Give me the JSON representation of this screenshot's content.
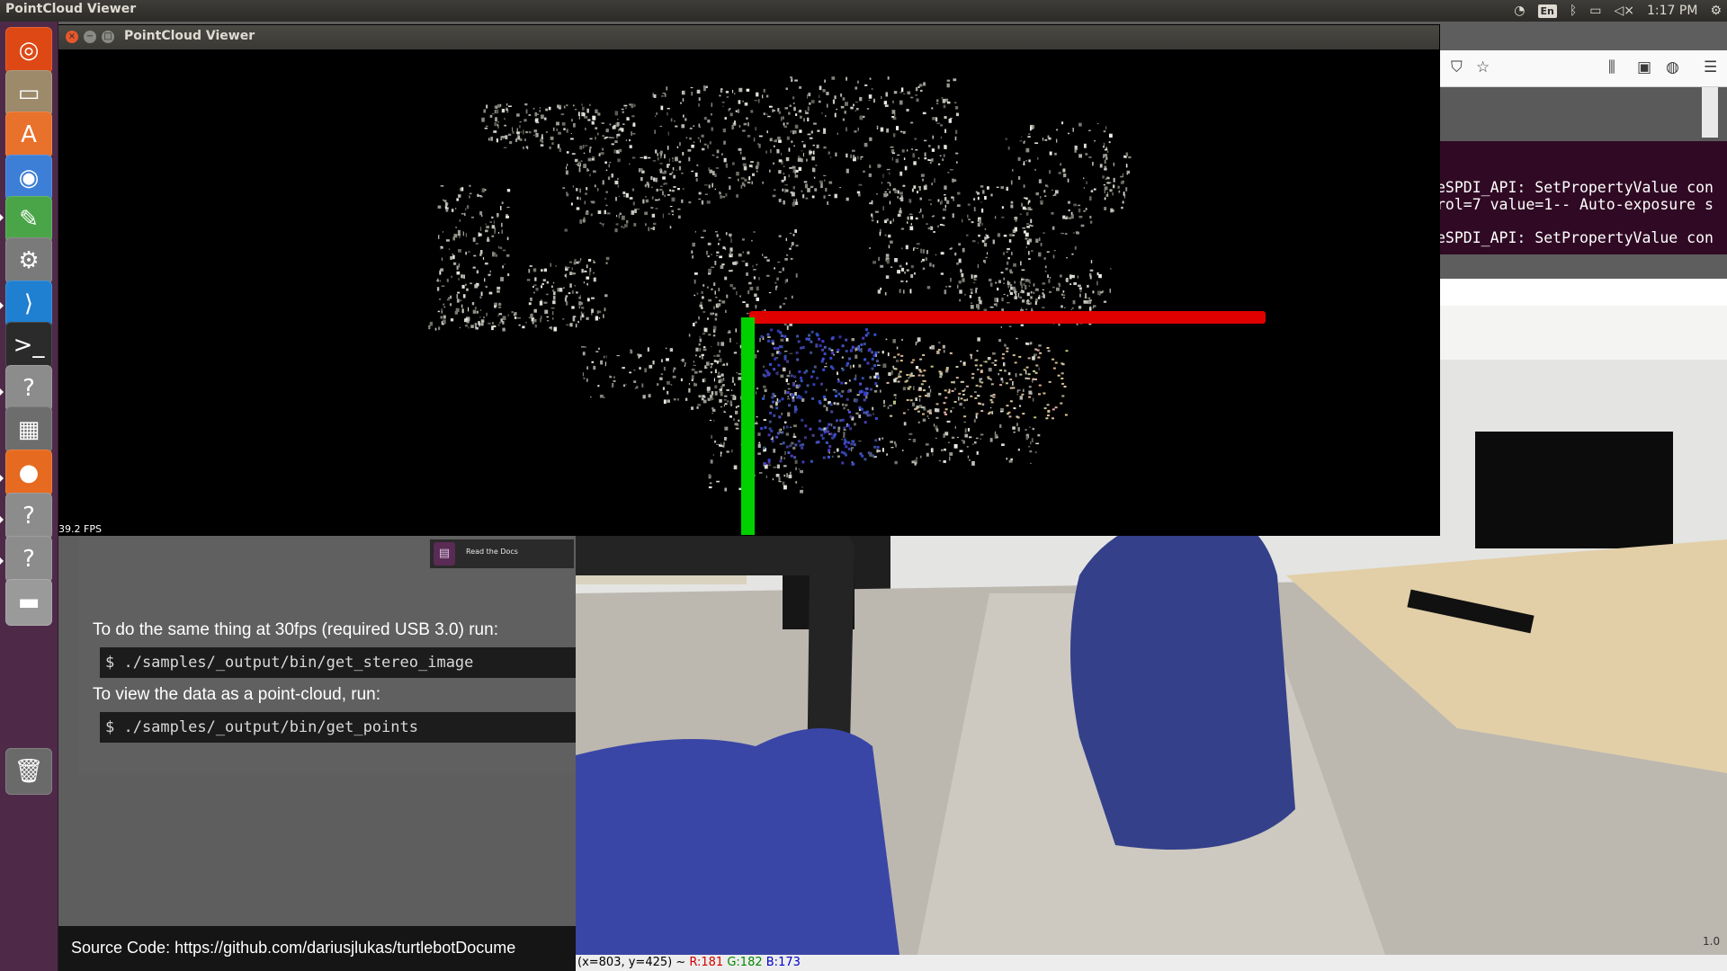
{
  "top_panel": {
    "app_title": "PointCloud Viewer",
    "keyboard_layout": "En",
    "clock": "1:17 PM"
  },
  "launcher": {
    "items": [
      {
        "name": "ubuntu-dash",
        "glyph": "◎",
        "color": "#dd4814"
      },
      {
        "name": "files",
        "glyph": "▭",
        "color": "#9c8a6a"
      },
      {
        "name": "software-center",
        "glyph": "A",
        "color": "#e8712c"
      },
      {
        "name": "chromium",
        "glyph": "◉",
        "color": "#3d7fd6"
      },
      {
        "name": "text-editor",
        "glyph": "✎",
        "color": "#4aa548"
      },
      {
        "name": "system-settings",
        "glyph": "⚙",
        "color": "#7a7a7a"
      },
      {
        "name": "vscode",
        "glyph": "⟩",
        "color": "#1f7fd0"
      },
      {
        "name": "terminal",
        "glyph": ">_",
        "color": "#2b2b2b"
      },
      {
        "name": "unknown-app-1",
        "glyph": "?",
        "color": "#8c8c8c"
      },
      {
        "name": "calculator",
        "glyph": "▦",
        "color": "#6d6d6d"
      },
      {
        "name": "firefox",
        "glyph": "●",
        "color": "#e66a1f"
      },
      {
        "name": "unknown-app-2",
        "glyph": "?",
        "color": "#8c8c8c"
      },
      {
        "name": "unknown-app-3",
        "glyph": "?",
        "color": "#8c8c8c"
      },
      {
        "name": "drive",
        "glyph": "▬",
        "color": "#9a9a9a"
      },
      {
        "name": "trash",
        "glyph": "🗑",
        "color": "#6a6a6a"
      }
    ]
  },
  "pointcloud_window": {
    "title": "PointCloud Viewer",
    "fps": "39.2 FPS",
    "axis_x_color": "#e00000",
    "axis_y_color": "#00d000"
  },
  "terminal": {
    "lines": [
      "eSPDI_API: SetPropertyValue con",
      "rol=7 value=1-- Auto-exposure s",
      "",
      "eSPDI_API: SetPropertyValue con"
    ]
  },
  "docs": {
    "rtd_label": "Read the Docs",
    "text_30fps": "To do the same thing at 30fps (required USB 3.0) run:",
    "code_stereo": "$ ./samples/_output/bin/get_stereo_image",
    "text_pointcloud": "To view the data as a point-cloud, run:",
    "code_points": "$ ./samples/_output/bin/get_points",
    "source_code": "Source Code: https://github.com/dariusjlukas/turtlebotDocume"
  },
  "camera_view": {
    "coords": "(x=803, y=425) ~",
    "r": "R:181",
    "g": "G:182",
    "b": "B:173",
    "corner": "1.0"
  }
}
